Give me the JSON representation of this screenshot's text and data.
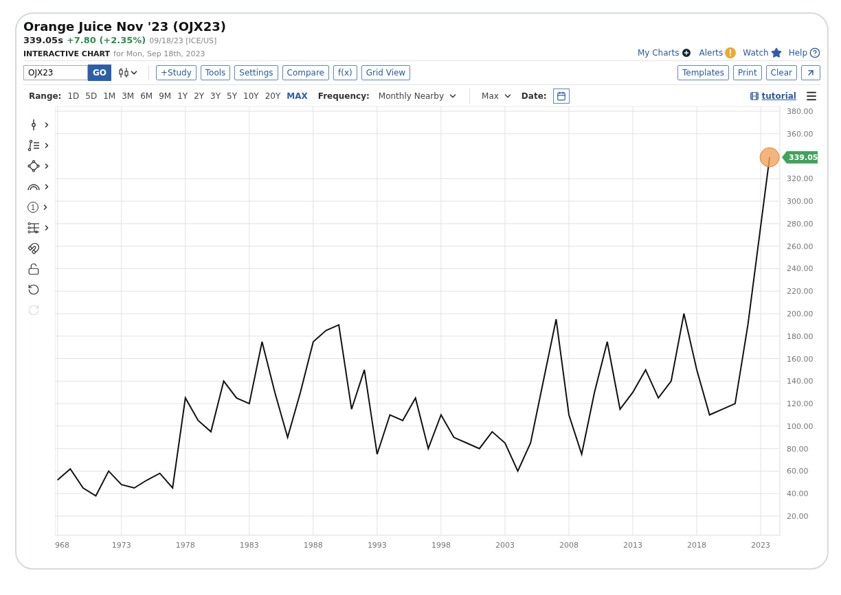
{
  "header": {
    "title": "Orange Juice Nov '23 (OJX23)",
    "price": "339.05s",
    "change": "+7.80 (+2.35%)",
    "meta": "09/18/23 [ICE/US]",
    "chart_label": "INTERACTIVE CHART",
    "date_text": "for Mon, Sep 18th, 2023"
  },
  "top_links": [
    {
      "label": "My Charts",
      "kind": "plus"
    },
    {
      "label": "Alerts",
      "kind": "alert"
    },
    {
      "label": "Watch",
      "kind": "star"
    },
    {
      "label": "Help",
      "kind": "help"
    }
  ],
  "toolbar": {
    "symbol": "OJX23",
    "go": "GO",
    "buttons": [
      "+Study",
      "Tools",
      "Settings",
      "Compare",
      "f(x)",
      "Grid View"
    ],
    "right_buttons": [
      "Templates",
      "Print",
      "Clear"
    ]
  },
  "range": {
    "label": "Range:",
    "options": [
      {
        "label": "1D",
        "selected": false
      },
      {
        "label": "5D",
        "selected": false
      },
      {
        "label": "1M",
        "selected": false
      },
      {
        "label": "3M",
        "selected": false
      },
      {
        "label": "6M",
        "selected": false
      },
      {
        "label": "9M",
        "selected": false
      },
      {
        "label": "1Y",
        "selected": false
      },
      {
        "label": "2Y",
        "selected": false
      },
      {
        "label": "3Y",
        "selected": false
      },
      {
        "label": "5Y",
        "selected": false
      },
      {
        "label": "10Y",
        "selected": false
      },
      {
        "label": "20Y",
        "selected": false
      },
      {
        "label": "MAX",
        "selected": true
      }
    ],
    "frequency_label": "Frequency:",
    "frequency": "Monthly Nearby",
    "period": "Max",
    "date_label": "Date:",
    "tutorial": "tutorial"
  },
  "drawing_tools": [
    {
      "kind": "crosshair",
      "submenu": true,
      "disabled": false
    },
    {
      "kind": "lines",
      "submenu": true,
      "disabled": false
    },
    {
      "kind": "shape",
      "submenu": true,
      "disabled": false
    },
    {
      "kind": "arc",
      "submenu": true,
      "disabled": false
    },
    {
      "kind": "counter",
      "label": "1",
      "submenu": true,
      "disabled": false
    },
    {
      "kind": "fork",
      "submenu": true,
      "disabled": false
    },
    {
      "kind": "magnet",
      "submenu": false,
      "disabled": false
    },
    {
      "kind": "lock",
      "submenu": false,
      "disabled": false
    },
    {
      "kind": "undo",
      "submenu": false,
      "disabled": false
    },
    {
      "kind": "redo",
      "submenu": false,
      "disabled": true
    }
  ],
  "chart": {
    "last_price_label": "339.05",
    "cut_axis_label": "968",
    "chart_data": {
      "type": "line",
      "x": [
        1968,
        1969,
        1970,
        1971,
        1972,
        1973,
        1974,
        1975,
        1976,
        1977,
        1978,
        1979,
        1980,
        1981,
        1982,
        1983,
        1984,
        1985,
        1986,
        1987,
        1988,
        1989,
        1990,
        1991,
        1992,
        1993,
        1994,
        1995,
        1996,
        1997,
        1998,
        1999,
        2000,
        2001,
        2002,
        2003,
        2004,
        2005,
        2006,
        2007,
        2008,
        2009,
        2010,
        2011,
        2012,
        2013,
        2014,
        2015,
        2016,
        2017,
        2018,
        2019,
        2020,
        2021,
        2022,
        2023.7
      ],
      "series": [
        {
          "color": "#111111",
          "values": [
            52,
            62,
            45,
            38,
            60,
            48,
            45,
            52,
            58,
            45,
            125,
            105,
            95,
            140,
            125,
            120,
            175,
            130,
            90,
            130,
            175,
            185,
            190,
            115,
            150,
            75,
            110,
            105,
            125,
            80,
            110,
            90,
            85,
            80,
            95,
            85,
            60,
            85,
            140,
            195,
            110,
            75,
            130,
            175,
            115,
            130,
            150,
            125,
            140,
            200,
            150,
            110,
            115,
            120,
            190,
            339
          ]
        }
      ],
      "xlim": [
        1967.8,
        2024.5
      ],
      "ylim": [
        2.9,
        384.3
      ],
      "grid": true,
      "xticks": [
        1973,
        1978,
        1983,
        1988,
        1993,
        1998,
        2003,
        2008,
        2013,
        2018,
        2023
      ],
      "yticks": [
        {
          "value": 20,
          "label": "20.00"
        },
        {
          "value": 40,
          "label": "40.00"
        },
        {
          "value": 60,
          "label": "60.00"
        },
        {
          "value": 80,
          "label": "80.00"
        },
        {
          "value": 100,
          "label": "100.00"
        },
        {
          "value": 120,
          "label": "120.00"
        },
        {
          "value": 140,
          "label": "140.00"
        },
        {
          "value": 160,
          "label": "160.00"
        },
        {
          "value": 180,
          "label": "180.00"
        },
        {
          "value": 200,
          "label": "200.00"
        },
        {
          "value": 220,
          "label": "220.00"
        },
        {
          "value": 240,
          "label": "240.00"
        },
        {
          "value": 260,
          "label": "260.00"
        },
        {
          "value": 280,
          "label": "280.00"
        },
        {
          "value": 300,
          "label": "300.00"
        },
        {
          "value": 320,
          "label": "320.00"
        },
        {
          "value": 360,
          "label": "360.00"
        },
        {
          "value": 380,
          "label": "380.00"
        }
      ]
    }
  }
}
